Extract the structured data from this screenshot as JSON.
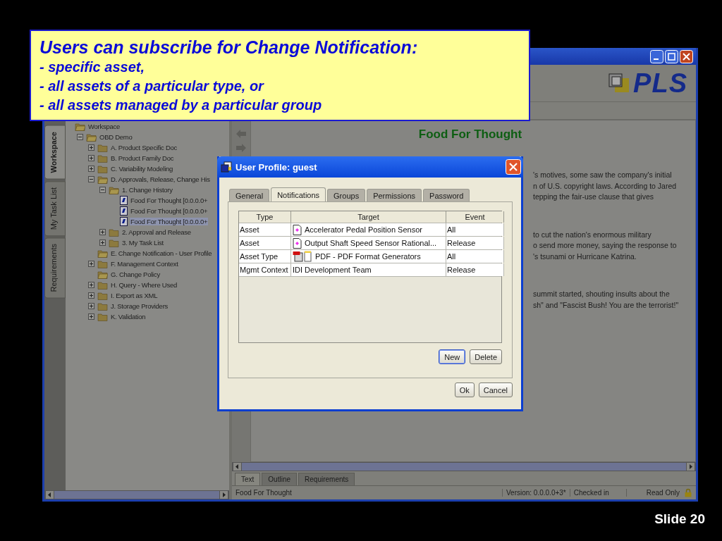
{
  "slide": {
    "callout": {
      "title": "Users can subscribe for Change Notification:",
      "bullets": [
        "- specific asset,",
        "- all assets of a particular type, or",
        "- all assets managed by a particular group"
      ]
    },
    "slide_number": "Slide 20"
  },
  "app": {
    "logo": "PLS",
    "side_tabs": [
      {
        "label": "Workspace",
        "selected": true
      },
      {
        "label": "My Task List",
        "selected": false
      },
      {
        "label": "Requirements",
        "selected": false
      }
    ],
    "tree": [
      {
        "label": "Workspace",
        "kind": "root",
        "selected": false,
        "children": [
          {
            "label": "OBD Demo",
            "kind": "branch",
            "expanded": true,
            "selected": false,
            "children": [
              {
                "label": "A. Product Specific Doc",
                "kind": "branch",
                "expanded": false,
                "selected": false
              },
              {
                "label": "B. Product Family Doc",
                "kind": "branch",
                "expanded": false,
                "selected": false
              },
              {
                "label": "C. Variability Modeling",
                "kind": "branch",
                "expanded": false,
                "selected": false
              },
              {
                "label": "D. Approvals, Release, Change His",
                "kind": "branch",
                "expanded": true,
                "selected": false,
                "children": [
                  {
                    "label": "1. Change History",
                    "kind": "branch",
                    "expanded": true,
                    "selected": false,
                    "children": [
                      {
                        "label": "Food For Thought [0.0.0.0+",
                        "kind": "document",
                        "selected": false
                      },
                      {
                        "label": "Food For Thought [0.0.0.0+",
                        "kind": "document",
                        "selected": false
                      },
                      {
                        "label": "Food For Thought [0.0.0.0+",
                        "kind": "document",
                        "selected": true
                      }
                    ]
                  },
                  {
                    "label": "2. Approval and Release",
                    "kind": "branch",
                    "expanded": false,
                    "selected": false
                  },
                  {
                    "label": "3. My Task List",
                    "kind": "branch",
                    "expanded": false,
                    "selected": false
                  }
                ]
              },
              {
                "label": "E. Change Notification - User Profile",
                "kind": "folder",
                "selected": false
              },
              {
                "label": "F. Management Context",
                "kind": "branch",
                "expanded": false,
                "selected": false
              },
              {
                "label": "G. Change Policy",
                "kind": "folder",
                "selected": false
              },
              {
                "label": "H. Query - Where Used",
                "kind": "branch",
                "expanded": false,
                "selected": false
              },
              {
                "label": "I. Export as XML",
                "kind": "branch",
                "expanded": false,
                "selected": false
              },
              {
                "label": "J. Storage Providers",
                "kind": "branch",
                "expanded": false,
                "selected": false
              },
              {
                "label": "K. Validation",
                "kind": "branch",
                "expanded": false,
                "selected": false
              }
            ]
          }
        ]
      }
    ],
    "document": {
      "heading": "Food For Thought",
      "paragraphs": [
        {
          "lines": [
            "'s motives, some saw the company's initial",
            "n of U.S. copyright laws. According to Jared",
            "tepping the fair-use clause that gives"
          ]
        },
        {
          "lines": [
            "to cut the nation's enormous military",
            "o send more money, saying the response to",
            "'s tsunami or Hurricane Katrina."
          ]
        },
        {
          "lines": [
            "summit started, shouting insults about the",
            "sh\" and \"Fascist Bush! You are the terrorist!\""
          ]
        }
      ]
    },
    "bottom_tabs": [
      {
        "label": "Text",
        "selected": true
      },
      {
        "label": "Outline",
        "selected": false
      },
      {
        "label": "Requirements",
        "selected": false
      }
    ],
    "status_bar": {
      "document": "Food For Thought",
      "version": "Version: 0.0.0.0+3*",
      "state": "Checked in",
      "access": "Read Only"
    }
  },
  "dialog": {
    "title": "User Profile: guest",
    "tabs": [
      {
        "label": "General",
        "selected": false
      },
      {
        "label": "Notifications",
        "selected": true
      },
      {
        "label": "Groups",
        "selected": false
      },
      {
        "label": "Permissions",
        "selected": false
      },
      {
        "label": "Password",
        "selected": false
      }
    ],
    "columns": [
      "Type",
      "Target",
      "Event"
    ],
    "rows": [
      {
        "type": "Asset",
        "target": "Accelerator Pedal Position Sensor",
        "event": "All",
        "kind": "asset"
      },
      {
        "type": "Asset",
        "target": "Output Shaft Speed Sensor Rational...",
        "event": "Release",
        "kind": "asset"
      },
      {
        "type": "Asset Type",
        "target": "PDF - PDF Format Generators",
        "event": "All",
        "kind": "asset-type"
      },
      {
        "type": "Mgmt Context",
        "target": "IDI Development Team",
        "event": "Release",
        "kind": "context"
      }
    ],
    "table_buttons": [
      {
        "label": "New",
        "focused": true
      },
      {
        "label": "Delete",
        "focused": false
      }
    ],
    "buttons": [
      {
        "label": "Ok",
        "focused": false
      },
      {
        "label": "Cancel",
        "focused": false
      }
    ]
  }
}
